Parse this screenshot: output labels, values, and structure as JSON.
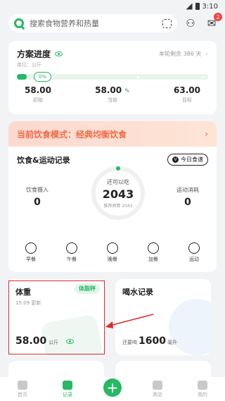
{
  "status": {
    "time": "3:10"
  },
  "search": {
    "placeholder": "搜索食物营养和热量"
  },
  "header": {
    "badge": "2"
  },
  "plan": {
    "title": "方案进度",
    "unit": "单位：公斤",
    "remaining": "本轮剩余 386 天",
    "progress": 0.05,
    "progress_label": "0%",
    "initial": {
      "value": "58.00",
      "label": "初始"
    },
    "current": {
      "value": "58.00",
      "label": "当前"
    },
    "target": {
      "value": "63.00",
      "label": "目标"
    }
  },
  "mode": {
    "text": "当前饮食模式：经典均衡饮食"
  },
  "intake": {
    "title": "饮食&运动记录",
    "recipe_label": "今日食谱",
    "center_label": "还可以吃",
    "center_value": "2043",
    "center_sub": "推荐预算 2043",
    "eaten_label": "饮食摄入",
    "eaten_value": "0",
    "burned_label": "运动消耗",
    "burned_value": "0",
    "meals": [
      "早餐",
      "午餐",
      "晚餐",
      "加餐",
      "运动"
    ]
  },
  "weight": {
    "title": "体重",
    "updated": "15:09 更新",
    "tag": "体脂秤",
    "value": "58.00",
    "unit": "公斤"
  },
  "water": {
    "title": "喝水记录",
    "prefix": "还要喝",
    "value": "1600",
    "unit": "毫升"
  },
  "tabs": [
    "首页",
    "记录",
    "商店",
    "我的"
  ],
  "colors": {
    "accent": "#27b864",
    "mode": "#f26a45",
    "annotation": "#d92c2c"
  }
}
